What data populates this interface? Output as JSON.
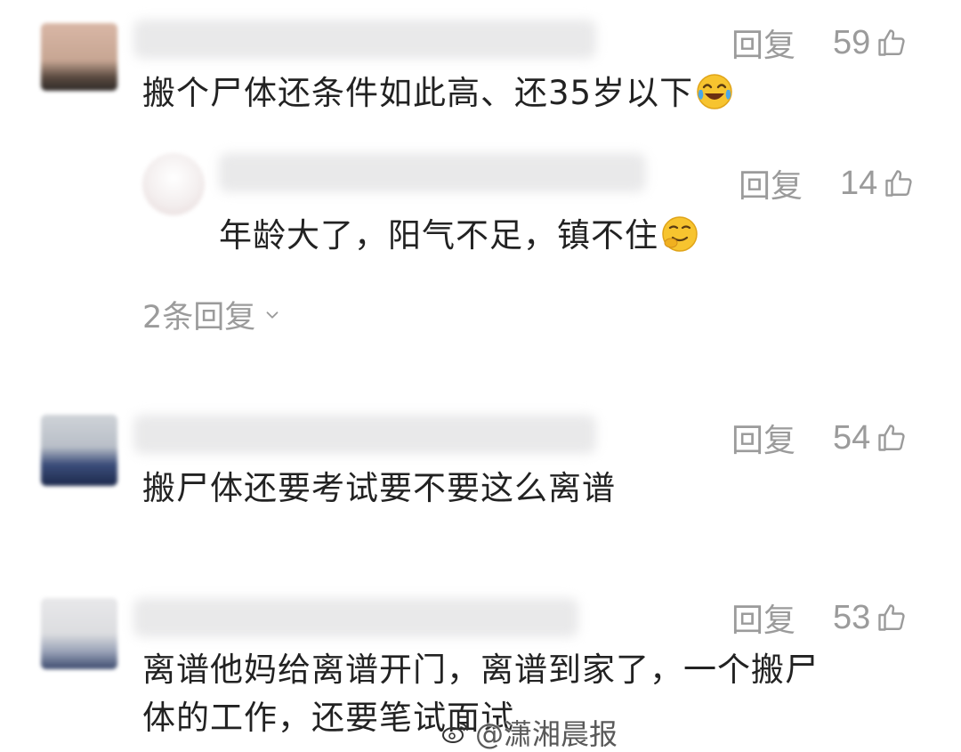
{
  "comments": [
    {
      "text": "搬个尸体还条件如此高、还35岁以下",
      "emoji": "laughing-crying-emoji",
      "reply_label": "回复",
      "likes": "59",
      "reply": {
        "text": "年龄大了，阳气不足，镇不住",
        "emoji": "snickering-emoji",
        "reply_label": "回复",
        "likes": "14"
      },
      "more_replies": "2条回复"
    },
    {
      "text": "搬尸体还要考试要不要这么离谱",
      "reply_label": "回复",
      "likes": "54"
    },
    {
      "text_line1": "离谱他妈给离谱开门，离谱到家了，一个搬尸",
      "text_line2": "体的工作，还要笔试面试",
      "reply_label": "回复",
      "likes": "53"
    }
  ],
  "watermark": "@潇湘晨报",
  "icons": {
    "like": "thumbs-up-icon",
    "expand": "chevron-down-icon",
    "weibo": "weibo-logo-icon"
  },
  "colors": {
    "text": "#222222",
    "meta": "#9b9b9b",
    "background": "#ffffff"
  }
}
